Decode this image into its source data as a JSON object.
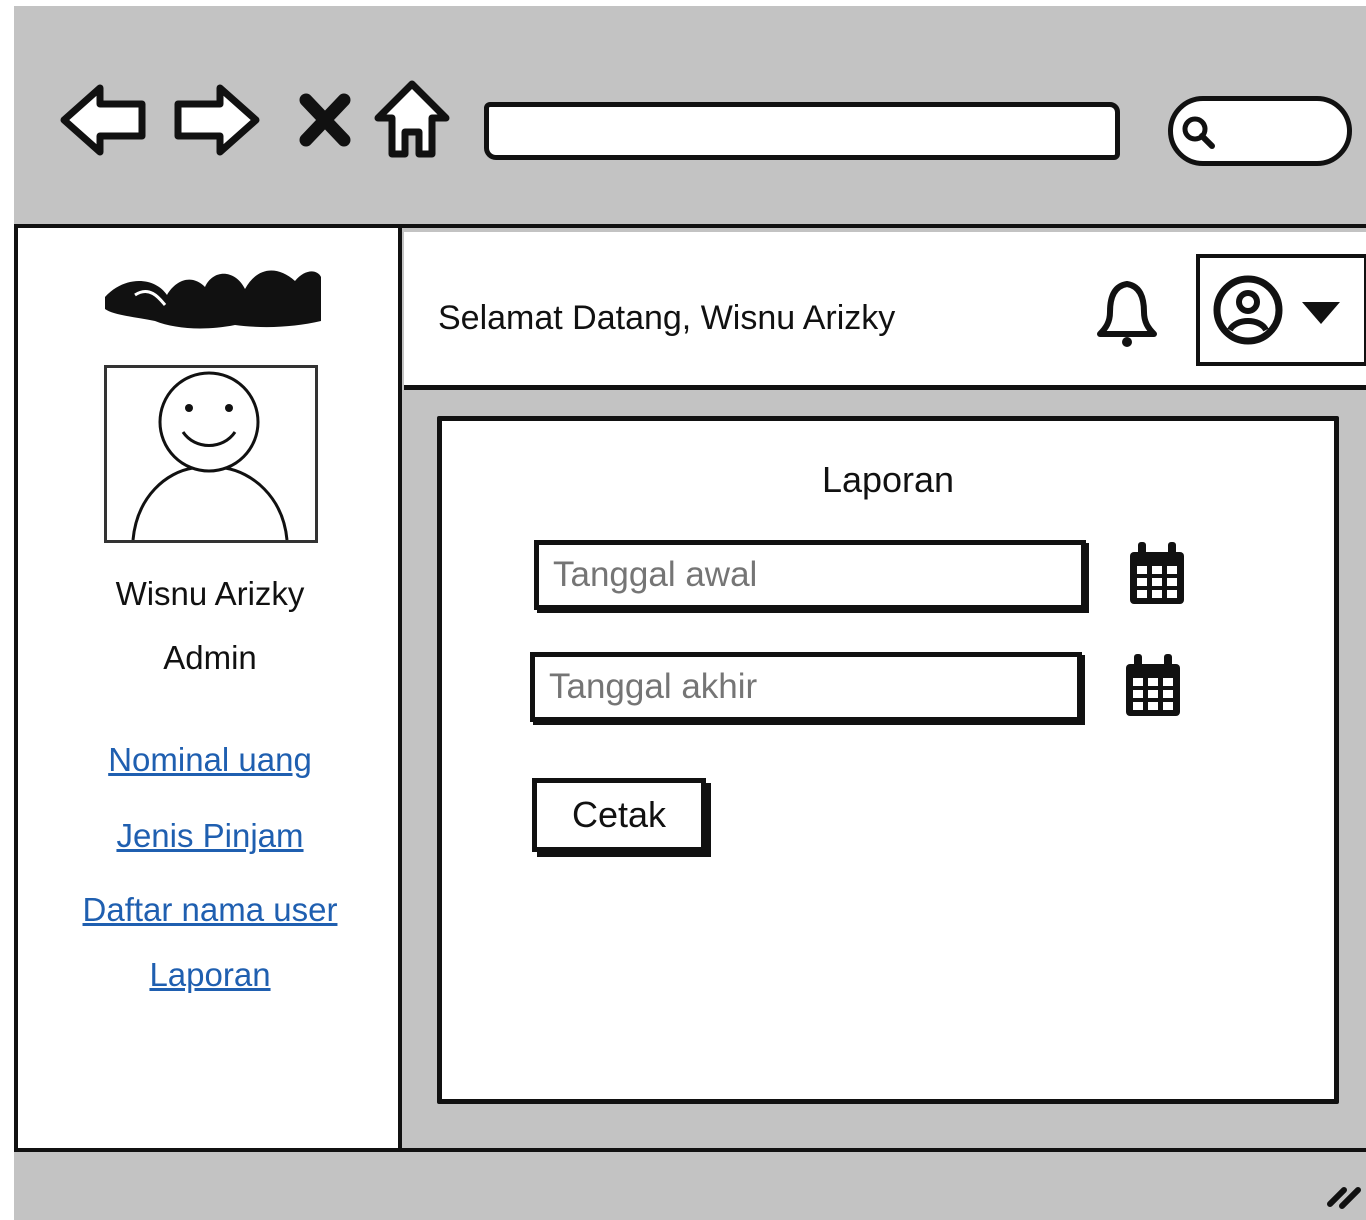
{
  "browser": {
    "back_icon": "back-arrow-icon",
    "forward_icon": "forward-arrow-icon",
    "close_icon": "close-icon",
    "home_icon": "home-icon",
    "search_icon": "search-icon",
    "url_value": "",
    "search_value": ""
  },
  "sidebar": {
    "logo_icon": "scribble-logo",
    "avatar_icon": "user-avatar-icon",
    "user_name": "Wisnu Arizky",
    "user_role": "Admin",
    "links": [
      {
        "label": "Nominal uang"
      },
      {
        "label": "Jenis Pinjam"
      },
      {
        "label": "Daftar nama user"
      },
      {
        "label": "Laporan"
      }
    ]
  },
  "header": {
    "welcome": "Selamat Datang, Wisnu Arizky",
    "bell_icon": "bell-icon",
    "profile_icon": "user-circle-icon",
    "dropdown_icon": "caret-down-icon"
  },
  "report": {
    "title": "Laporan",
    "start_date_placeholder": "Tanggal awal",
    "end_date_placeholder": "Tanggal akhir",
    "calendar_icon": "calendar-icon",
    "print_label": "Cetak"
  },
  "colors": {
    "chrome": "#c3c3c3",
    "link": "#1f5fb0",
    "ink": "#111111"
  }
}
